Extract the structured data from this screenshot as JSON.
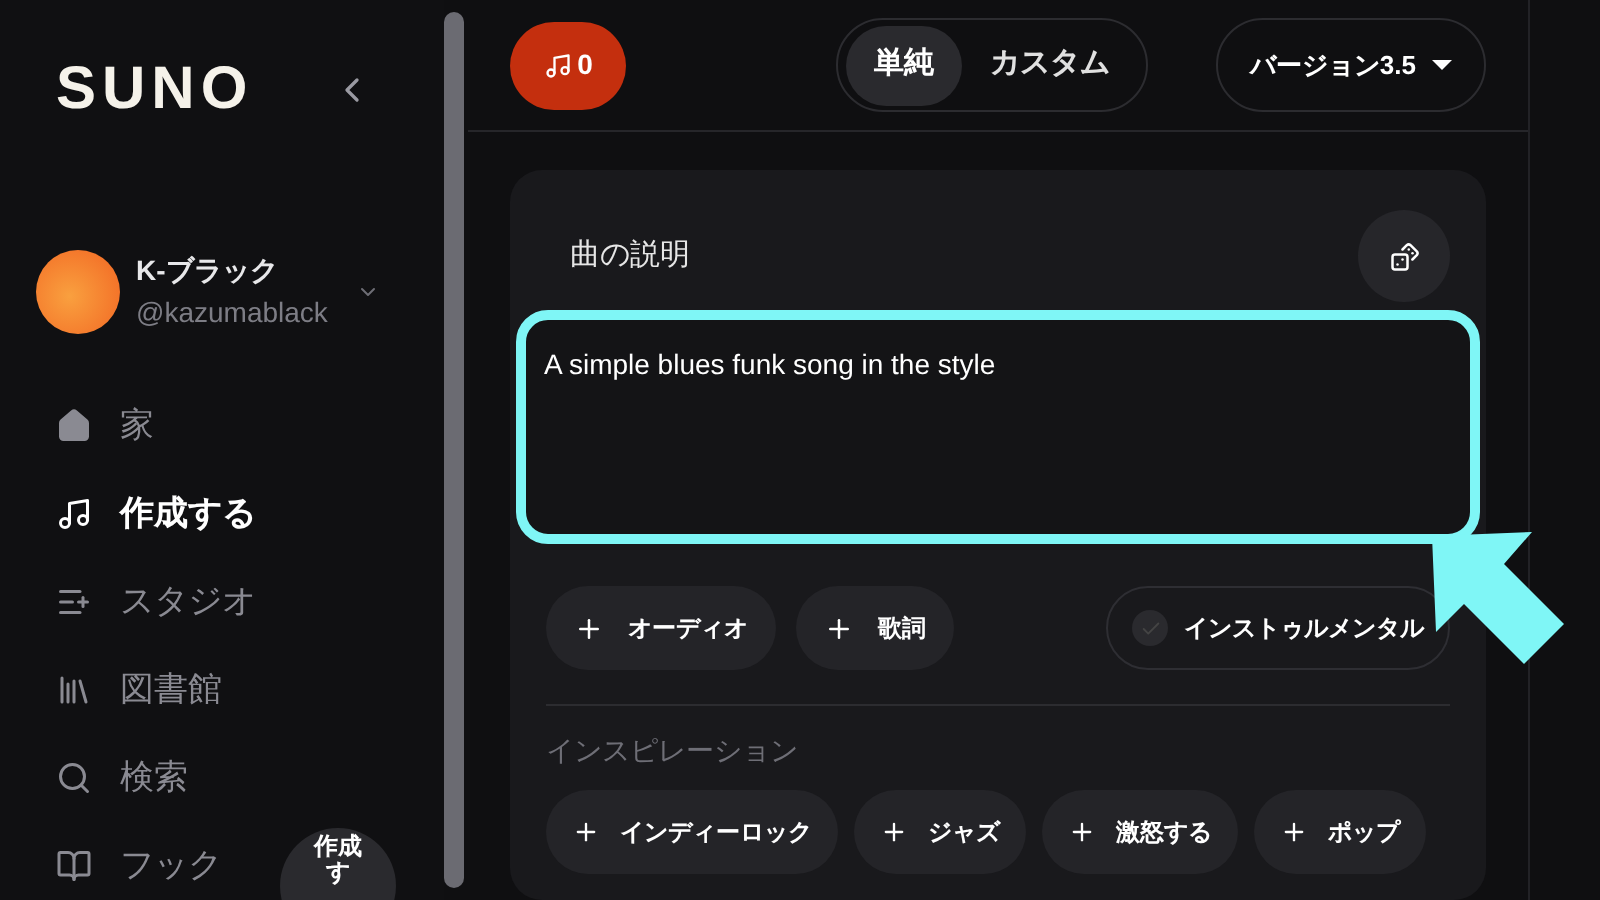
{
  "sidebar": {
    "logo": "SUNO",
    "user": {
      "name": "K-ブラック",
      "handle": "@kazumablack"
    },
    "nav": [
      {
        "kind": "home",
        "label": "家",
        "selected": false
      },
      {
        "kind": "create",
        "label": "作成する",
        "selected": true
      },
      {
        "kind": "studio",
        "label": "スタジオ",
        "selected": false
      },
      {
        "kind": "library",
        "label": "図書館",
        "selected": false
      },
      {
        "kind": "search",
        "label": "検索",
        "selected": false
      },
      {
        "kind": "hook",
        "label": "フック",
        "selected": false
      }
    ],
    "create_fab": "作成す"
  },
  "header": {
    "credits": "0",
    "modes": [
      {
        "label": "単純",
        "selected": true
      },
      {
        "label": "カスタム",
        "selected": false
      }
    ],
    "version": "バージョン3.5"
  },
  "form": {
    "description_label": "曲の説明",
    "description_value": "A simple blues funk song in the style",
    "add_buttons": [
      "オーディオ",
      "歌詞"
    ],
    "instrumental": {
      "label": "インストゥルメンタル",
      "checked": false
    },
    "inspiration_label": "インスピレーション",
    "inspirations": [
      "インディーロック",
      "ジャズ",
      "激怒する",
      "ポップ"
    ]
  }
}
